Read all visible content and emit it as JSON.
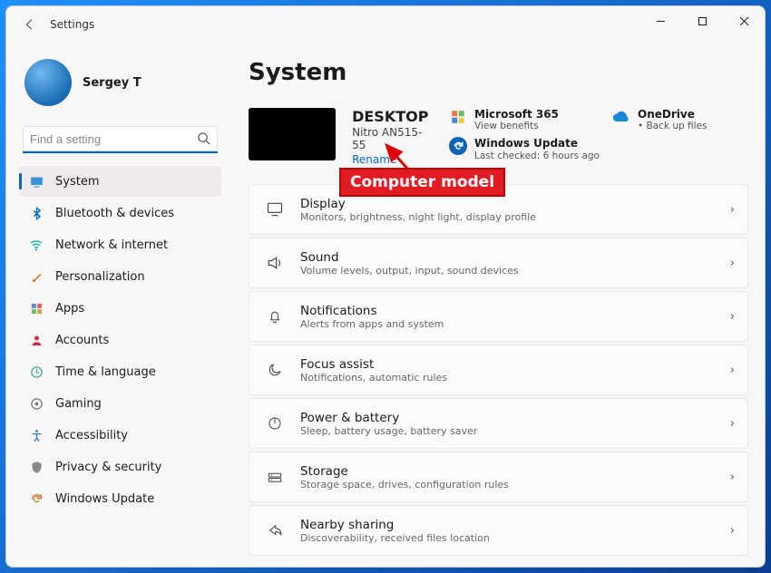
{
  "window": {
    "title": "Settings"
  },
  "account": {
    "name": "Sergey T"
  },
  "search": {
    "placeholder": "Find a setting"
  },
  "sidebar": {
    "items": [
      {
        "label": "System"
      },
      {
        "label": "Bluetooth & devices"
      },
      {
        "label": "Network & internet"
      },
      {
        "label": "Personalization"
      },
      {
        "label": "Apps"
      },
      {
        "label": "Accounts"
      },
      {
        "label": "Time & language"
      },
      {
        "label": "Gaming"
      },
      {
        "label": "Accessibility"
      },
      {
        "label": "Privacy & security"
      },
      {
        "label": "Windows Update"
      }
    ]
  },
  "page": {
    "heading": "System",
    "device_name": "DESKTOP",
    "device_model": "Nitro AN515-55",
    "rename": "Rename"
  },
  "tiles": {
    "m365": {
      "title": "Microsoft 365",
      "sub": "View benefits"
    },
    "onedrive": {
      "title": "OneDrive",
      "sub": "Back up files"
    },
    "update": {
      "title": "Windows Update",
      "sub": "Last checked: 6 hours ago"
    }
  },
  "settings": [
    {
      "title": "Display",
      "sub": "Monitors, brightness, night light, display profile"
    },
    {
      "title": "Sound",
      "sub": "Volume levels, output, input, sound devices"
    },
    {
      "title": "Notifications",
      "sub": "Alerts from apps and system"
    },
    {
      "title": "Focus assist",
      "sub": "Notifications, automatic rules"
    },
    {
      "title": "Power & battery",
      "sub": "Sleep, battery usage, battery saver"
    },
    {
      "title": "Storage",
      "sub": "Storage space, drives, configuration rules"
    },
    {
      "title": "Nearby sharing",
      "sub": "Discoverability, received files location"
    }
  ],
  "callout": "Computer model"
}
